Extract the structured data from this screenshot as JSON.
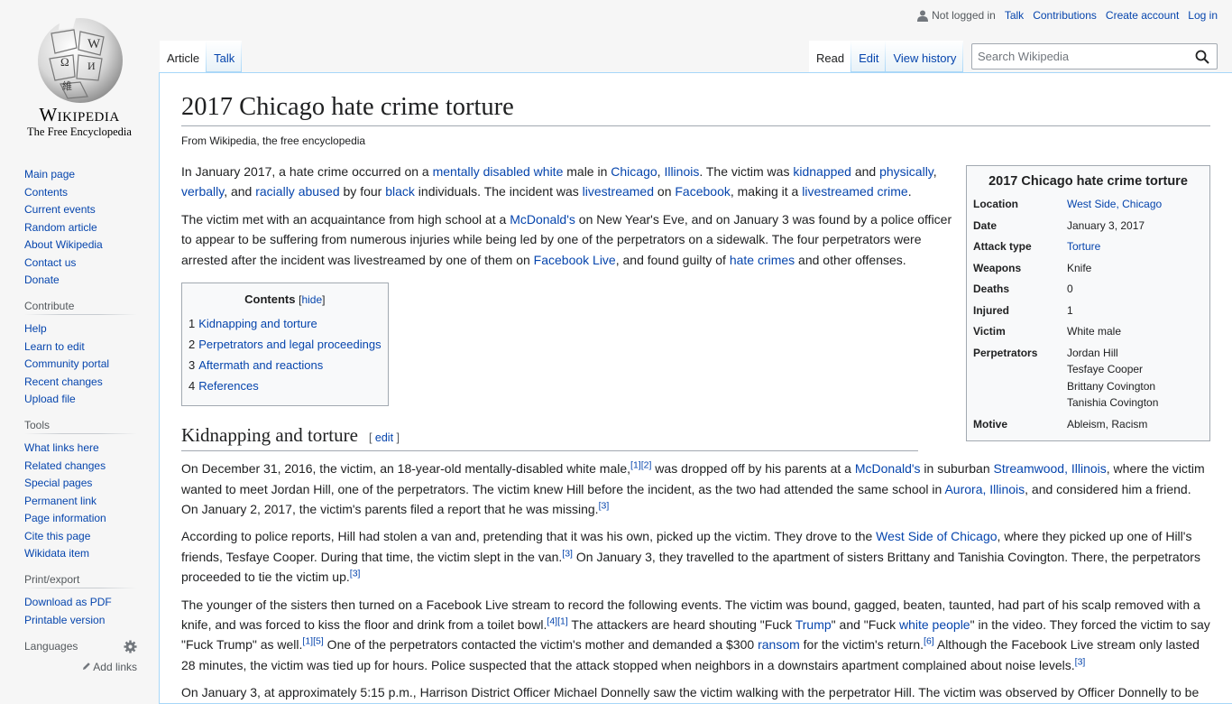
{
  "site": {
    "wordmark": "Wikipedia",
    "tagline": "The Free Encyclopedia"
  },
  "personal": {
    "not_logged_in": "Not logged in",
    "talk": "Talk",
    "contributions": "Contributions",
    "create_account": "Create account",
    "log_in": "Log in"
  },
  "tabs": {
    "article": "Article",
    "talk": "Talk",
    "read": "Read",
    "edit": "Edit",
    "view_history": "View history"
  },
  "search": {
    "placeholder": "Search Wikipedia"
  },
  "sidebar": {
    "navigation": [
      "Main page",
      "Contents",
      "Current events",
      "Random article",
      "About Wikipedia",
      "Contact us",
      "Donate"
    ],
    "contribute_heading": "Contribute",
    "contribute": [
      "Help",
      "Learn to edit",
      "Community portal",
      "Recent changes",
      "Upload file"
    ],
    "tools_heading": "Tools",
    "tools": [
      "What links here",
      "Related changes",
      "Special pages",
      "Permanent link",
      "Page information",
      "Cite this page",
      "Wikidata item"
    ],
    "print_heading": "Print/export",
    "print": [
      "Download as PDF",
      "Printable version"
    ],
    "languages_heading": "Languages",
    "add_links": "Add links"
  },
  "article": {
    "title": "2017 Chicago hate crime torture",
    "subtitle": "From Wikipedia, the free encyclopedia",
    "p1": [
      "In January 2017, a hate crime occurred on a ",
      "mentally disabled",
      " ",
      "white",
      " male in ",
      "Chicago",
      ", ",
      "Illinois",
      ". The victim was ",
      "kidnapped",
      " and ",
      "physically",
      ", ",
      "verbally",
      ", and ",
      "racially abused",
      " by four ",
      "black",
      " individuals. The incident was ",
      "livestreamed",
      " on ",
      "Facebook",
      ", making it a ",
      "livestreamed crime",
      "."
    ],
    "p2": [
      "The victim met with an acquaintance from high school at a ",
      "McDonald's",
      " on New Year's Eve, and on January 3 was found by a police officer to appear to be suffering from numerous injuries while being led by one of the perpetrators on a sidewalk. The four perpetrators were arrested after the incident was livestreamed by one of them on ",
      "Facebook Live",
      ", and found guilty of ",
      "hate crimes",
      " and other offenses."
    ],
    "toc": {
      "title": "Contents",
      "hide": "hide",
      "items": [
        {
          "num": "1",
          "label": "Kidnapping and torture"
        },
        {
          "num": "2",
          "label": "Perpetrators and legal proceedings"
        },
        {
          "num": "3",
          "label": "Aftermath and reactions"
        },
        {
          "num": "4",
          "label": "References"
        }
      ]
    },
    "section1": {
      "heading": "Kidnapping and torture",
      "edit": "edit"
    },
    "p3": [
      "On December 31, 2016, the victim, an 18-year-old mentally-disabled white male,",
      "[1]",
      "[2]",
      " was dropped off by his parents at a ",
      "McDonald's",
      " in suburban ",
      "Streamwood, Illinois",
      ", where the victim wanted to meet Jordan Hill, one of the perpetrators. The victim knew Hill before the incident, as the two had attended the same school in ",
      "Aurora, Illinois",
      ", and considered him a friend. On January 2, 2017, the victim's parents filed a report that he was missing.",
      "[3]"
    ],
    "p4": [
      "According to police reports, Hill had stolen a van and, pretending that it was his own, picked up the victim. They drove to the ",
      "West Side of Chicago",
      ", where they picked up one of Hill's friends, Tesfaye Cooper. During that time, the victim slept in the van.",
      "[3]",
      " On January 3, they travelled to the apartment of sisters Brittany and Tanishia Covington. There, the perpetrators proceeded to tie the victim up.",
      "[3]"
    ],
    "p5": [
      "The younger of the sisters then turned on a Facebook Live stream to record the following events. The victim was bound, gagged, beaten, taunted, had part of his scalp removed with a knife, and was forced to kiss the floor and drink from a toilet bowl.",
      "[4]",
      "[1]",
      " The attackers are heard shouting \"Fuck ",
      "Trump",
      "\" and \"Fuck ",
      "white people",
      "\" in the video. They forced the victim to say \"Fuck Trump\" as well.",
      "[1]",
      "[5]",
      " One of the perpetrators contacted the victim's mother and demanded a $300 ",
      "ransom",
      " for the victim's return.",
      "[6]",
      " Although the Facebook Live stream only lasted 28 minutes, the victim was tied up for hours. Police suspected that the attack stopped when neighbors in a downstairs apartment complained about noise levels.",
      "[3]"
    ],
    "p6": "On January 3, at approximately 5:15 p.m., Harrison District Officer Michael Donnelly saw the victim walking with the perpetrator Hill. The victim was observed by Officer Donnelly to be"
  },
  "infobox": {
    "title": "2017 Chicago hate crime torture",
    "rows": [
      {
        "label": "Location",
        "value": "West Side, Chicago"
      },
      {
        "label": "Date",
        "value": "January 3, 2017"
      },
      {
        "label": "Attack type",
        "value": "Torture"
      },
      {
        "label": "Weapons",
        "value": "Knife"
      },
      {
        "label": "Deaths",
        "value": "0"
      },
      {
        "label": "Injured",
        "value": "1"
      },
      {
        "label": "Victim",
        "value": "White male"
      },
      {
        "label": "Perpetrators",
        "values": [
          "Jordan Hill",
          "Tesfaye Cooper",
          "Brittany Covington",
          "Tanishia Covington"
        ]
      },
      {
        "label": "Motive",
        "value": "Ableism, Racism"
      }
    ]
  }
}
